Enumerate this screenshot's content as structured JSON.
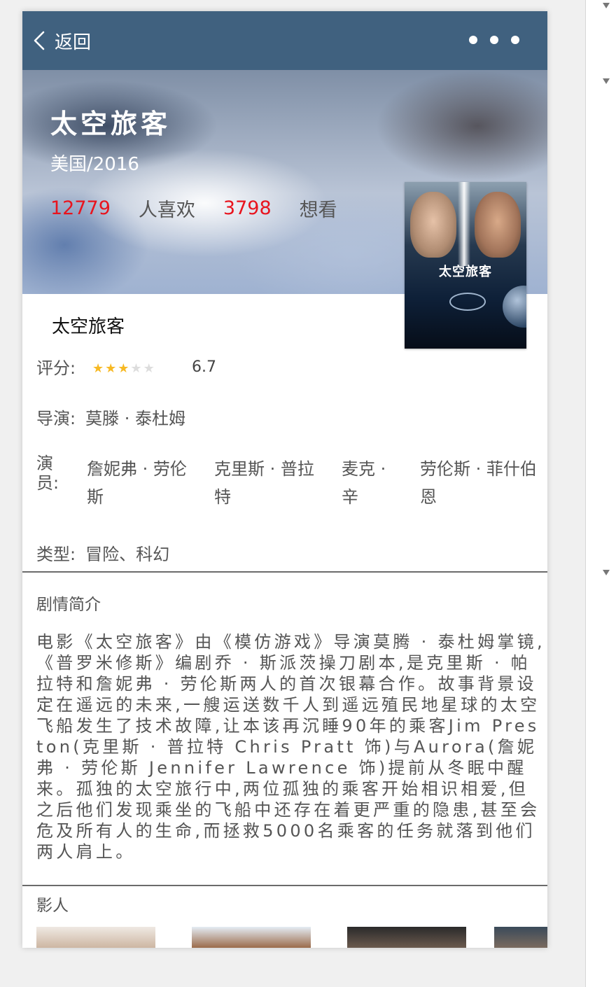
{
  "nav": {
    "back_label": "返回"
  },
  "movie": {
    "title": "太空旅客",
    "origin": "美国/2016",
    "likes": {
      "count": "12779",
      "label": "人喜欢"
    },
    "wants": {
      "count": "3798",
      "label": "想看"
    },
    "poster_title": "太空旅客",
    "subtitle": "太空旅客"
  },
  "details": {
    "rating_label": "评分:",
    "rating_value": "6.7",
    "rating_stars": 3,
    "rating_max": 5,
    "director_label": "导演:",
    "director": "莫滕 · 泰杜姆",
    "cast_label": "演员:",
    "cast": [
      "詹妮弗 · 劳伦斯",
      "克里斯 · 普拉特",
      "麦克 · 辛",
      "劳伦斯 · 菲什伯恩"
    ],
    "genre_label": "类型:",
    "genre": "冒险、科幻"
  },
  "synopsis": {
    "heading": "剧情简介",
    "text": "电影《太空旅客》由《模仿游戏》导演莫腾 · 泰杜姆掌镜,《普罗米修斯》编剧乔 · 斯派茨操刀剧本,是克里斯 · 帕拉特和詹妮弗 · 劳伦斯两人的首次银幕合作。故事背景设定在遥远的未来,一艘运送数千人到遥远殖民地星球的太空飞船发生了技术故障,让本该再沉睡90年的乘客Jim Preston(克里斯 · 普拉特 Chris Pratt 饰)与Aurora(詹妮弗 · 劳伦斯 Jennifer Lawrence 饰)提前从冬眠中醒来。孤独的太空旅行中,两位孤独的乘客开始相识相爱,但之后他们发现乘坐的飞船中还存在着更严重的隐患,甚至会危及所有人的生命,而拯救5000名乘客的任务就落到他们两人肩上。"
  },
  "people": {
    "heading": "影人"
  },
  "colors": {
    "nav_bg": "#40617f",
    "accent_red": "#e8141e",
    "star_on": "#f7b924",
    "star_off": "#dddddd"
  }
}
